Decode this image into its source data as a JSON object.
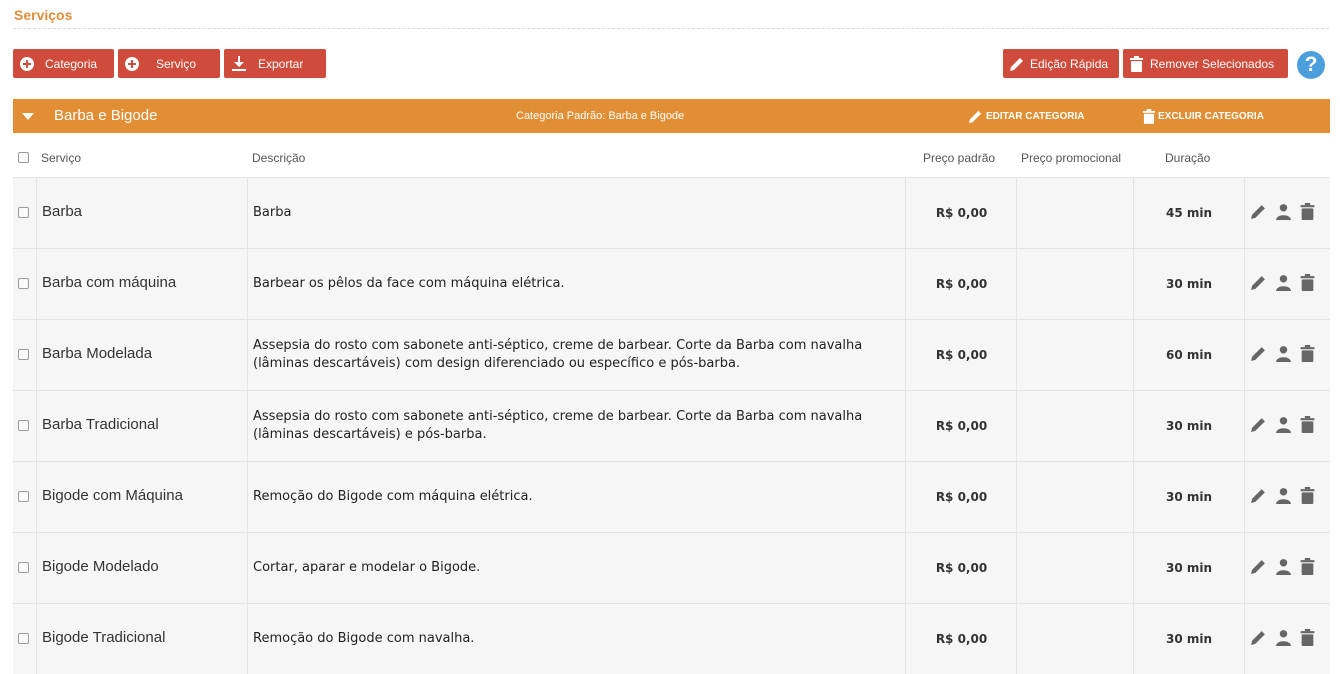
{
  "page": {
    "title": "Serviços"
  },
  "toolbar": {
    "category_label": "Categoria",
    "service_label": "Serviço",
    "export_label": "Exportar",
    "quick_edit_label": "Edição Rápida",
    "remove_selected_label": "Remover Selecionados",
    "help_symbol": "?"
  },
  "category": {
    "name": "Barba e Bigode",
    "default_text": "Categoria Padrão: Barba e Bigode",
    "edit_label": "EDITAR CATEGORIA",
    "delete_label": "EXCLUIR CATEGORIA"
  },
  "table": {
    "headers": {
      "service": "Serviço",
      "description": "Descrição",
      "standard_price": "Preço padrão",
      "promo_price": "Preço promocional",
      "duration": "Duração"
    },
    "rows": [
      {
        "service": "Barba",
        "description": "Barba",
        "price": "R$ 0,00",
        "promo": "",
        "duration": "45 min"
      },
      {
        "service": "Barba com máquina",
        "description": "Barbear os pêlos da face com máquina elétrica.",
        "price": "R$ 0,00",
        "promo": "",
        "duration": "30 min"
      },
      {
        "service": "Barba Modelada",
        "description": "Assepsia do rosto com sabonete anti-séptico, creme de barbear. Corte da Barba com navalha (lâminas descartáveis) com design diferenciado ou específico e pós-barba.",
        "price": "R$ 0,00",
        "promo": "",
        "duration": "60 min"
      },
      {
        "service": "Barba Tradicional",
        "description": "Assepsia do rosto com sabonete anti-séptico, creme de barbear. Corte da Barba com navalha (lâminas descartáveis) e pós-barba.",
        "price": "R$ 0,00",
        "promo": "",
        "duration": "30 min"
      },
      {
        "service": "Bigode com Máquina",
        "description": "Remoção do Bigode com máquina elétrica.",
        "price": "R$ 0,00",
        "promo": "",
        "duration": "30 min"
      },
      {
        "service": "Bigode Modelado",
        "description": "Cortar, aparar e modelar o Bigode.",
        "price": "R$ 0,00",
        "promo": "",
        "duration": "30 min"
      },
      {
        "service": "Bigode Tradicional",
        "description": "Remoção do Bigode com navalha.",
        "price": "R$ 0,00",
        "promo": "",
        "duration": "30 min"
      }
    ]
  },
  "icons": {
    "add": "plus-circle-icon",
    "export": "download-icon",
    "quick_edit": "pencil-icon",
    "remove": "trash-icon",
    "help": "question-circle-icon",
    "row_edit": "pencil-icon",
    "row_professionals": "user-icon",
    "row_delete": "trash-icon"
  },
  "colors": {
    "accent_orange": "#e18e35",
    "title_orange": "#e08e3a",
    "button_red": "#cf4b3c",
    "help_blue": "#4a9fdc",
    "icon_gray": "#666666"
  }
}
